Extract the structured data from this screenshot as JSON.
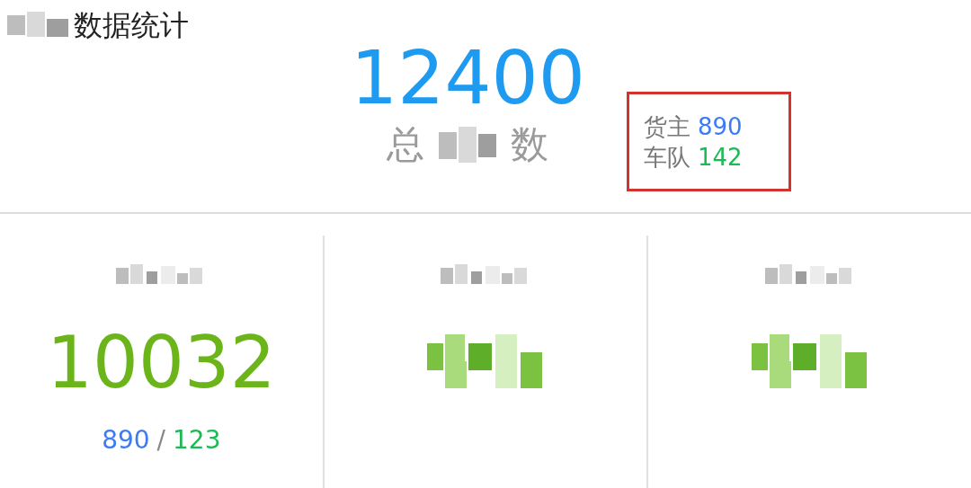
{
  "header": {
    "title": "数据统计",
    "total": "12400",
    "total_label_start": "总",
    "total_label_end": "数"
  },
  "breakdown": {
    "highlighted": true,
    "items": [
      {
        "label": "货主",
        "value": "890",
        "color": "#3d7bf5"
      },
      {
        "label": "车队",
        "value": "142",
        "color": "#1db954"
      }
    ]
  },
  "stats": [
    {
      "kind": "visible",
      "value": "10032",
      "sub_a": "890",
      "separator": "/",
      "sub_b": "123"
    },
    {
      "kind": "redacted"
    },
    {
      "kind": "redacted"
    }
  ]
}
